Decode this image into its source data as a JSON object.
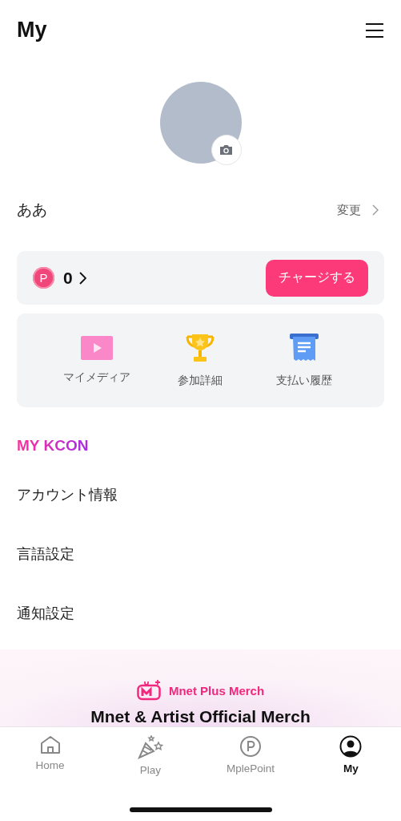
{
  "header": {
    "title": "My"
  },
  "profile": {
    "name": "ああ",
    "change_link": "変更"
  },
  "points": {
    "badge": "P",
    "amount": "0",
    "charge_button": "チャージする"
  },
  "shortcuts": [
    {
      "kind": "media",
      "label": "マイメディア"
    },
    {
      "kind": "trophy",
      "label": "参加詳細"
    },
    {
      "kind": "receipt",
      "label": "支払い履歴"
    }
  ],
  "section_title": "MY KCON",
  "menu": [
    {
      "label": "アカウント情報"
    },
    {
      "label": "言語設定"
    },
    {
      "label": "通知設定"
    }
  ],
  "banner": {
    "brand": "Mnet Plus Merch",
    "headline": "Mnet & Artist Official Merch"
  },
  "nav": [
    {
      "kind": "home",
      "label": "Home",
      "selected": false
    },
    {
      "kind": "play",
      "label": "Play",
      "selected": false
    },
    {
      "kind": "point",
      "label": "MplePoint",
      "selected": false
    },
    {
      "kind": "my",
      "label": "My",
      "selected": true
    }
  ]
}
